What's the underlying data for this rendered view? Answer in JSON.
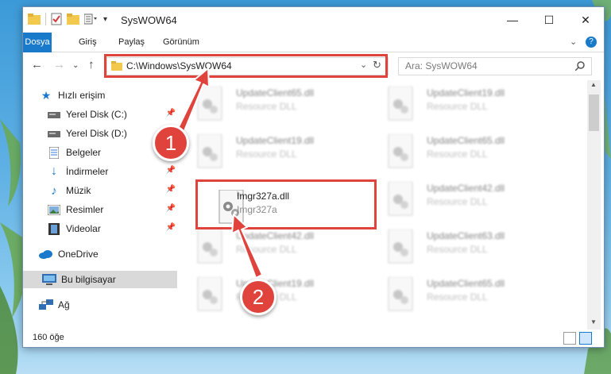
{
  "window": {
    "title": "SysWOW64"
  },
  "ribbon": {
    "tabs": [
      "Dosya",
      "Giriş",
      "Paylaş",
      "Görünüm"
    ]
  },
  "address": {
    "path": "C:\\Windows\\SysWOW64",
    "search_placeholder": "Ara: SysWOW64"
  },
  "sidebar": {
    "items": [
      {
        "label": "Hızlı erişim",
        "icon": "star-icon"
      },
      {
        "label": "Yerel Disk (C:)",
        "icon": "drive-icon",
        "pinned": true
      },
      {
        "label": "Yerel Disk (D:)",
        "icon": "drive-icon",
        "pinned": true
      },
      {
        "label": "Belgeler",
        "icon": "documents-icon",
        "pinned": true
      },
      {
        "label": "İndirmeler",
        "icon": "download-icon",
        "pinned": true
      },
      {
        "label": "Müzik",
        "icon": "music-icon",
        "pinned": true
      },
      {
        "label": "Resimler",
        "icon": "pictures-icon",
        "pinned": true
      },
      {
        "label": "Videolar",
        "icon": "videos-icon",
        "pinned": true
      },
      {
        "label": "OneDrive",
        "icon": "cloud-icon"
      },
      {
        "label": "Bu bilgisayar",
        "icon": "computer-icon",
        "selected": true
      },
      {
        "label": "Ağ",
        "icon": "network-icon"
      }
    ]
  },
  "files": [
    {
      "name": "UpdateClient65.dll",
      "desc": "Resource DLL",
      "blurred": true
    },
    {
      "name": "UpdateClient19.dll",
      "desc": "Resource DLL",
      "blurred": true
    },
    {
      "name": "UpdateClient19.dll",
      "desc": "Resource DLL",
      "blurred": true
    },
    {
      "name": "UpdateClient65.dll",
      "desc": "Resource DLL",
      "blurred": true
    },
    {
      "name": "Imgr327a.dll",
      "desc": "Imgr327a",
      "blurred": false
    },
    {
      "name": "UpdateClient42.dll",
      "desc": "Resource DLL",
      "blurred": true
    },
    {
      "name": "UpdateClient42.dll",
      "desc": "Resource DLL",
      "blurred": true
    },
    {
      "name": "UpdateClient63.dll",
      "desc": "Resource DLL",
      "blurred": true
    },
    {
      "name": "UpdateClient19.dll",
      "desc": "Resource DLL",
      "blurred": true
    },
    {
      "name": "UpdateClient65.dll",
      "desc": "Resource DLL",
      "blurred": true
    }
  ],
  "status": {
    "count": "160 öğe"
  },
  "callouts": {
    "step1": "1",
    "step2": "2"
  },
  "colors": {
    "accent": "#1979ca",
    "highlight": "#e0433b",
    "selected": "#d9d9d9"
  }
}
